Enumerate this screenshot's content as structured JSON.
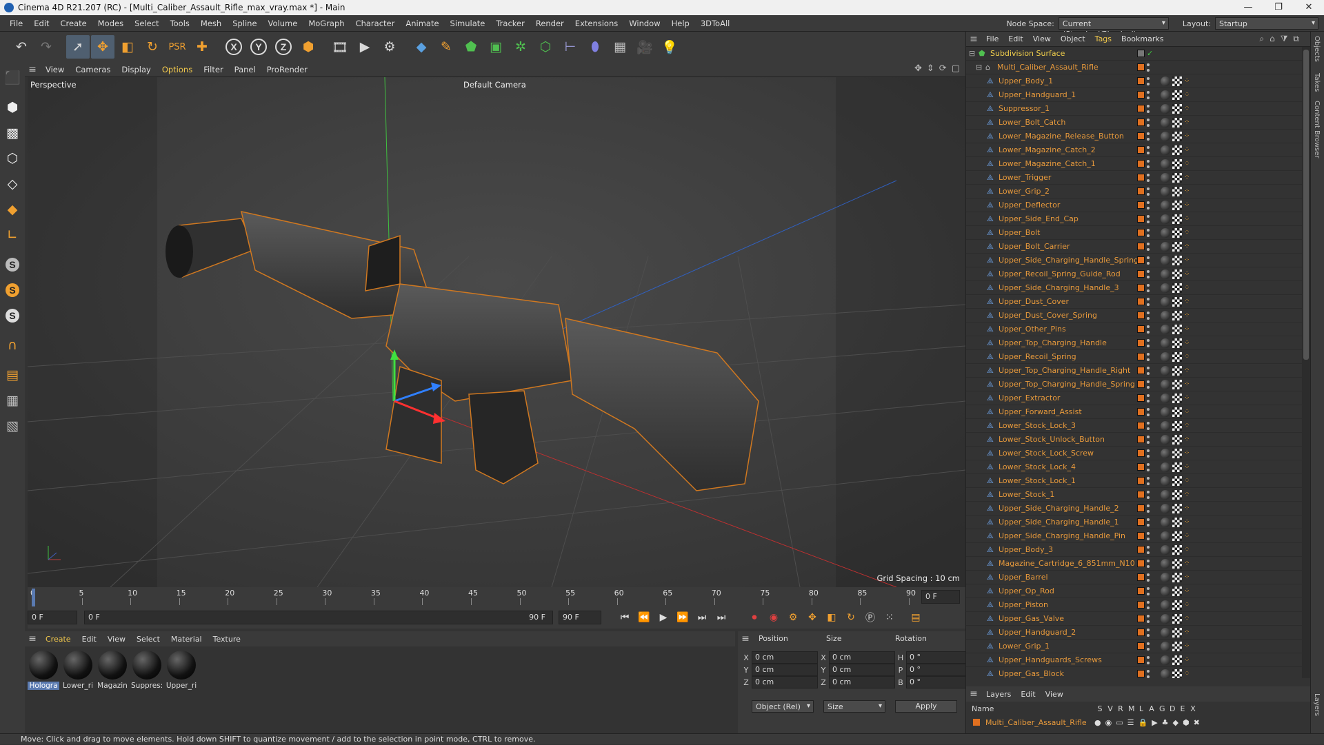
{
  "window": {
    "title": "Cinema 4D R21.207 (RC) - [Multi_Caliber_Assault_Rifle_max_vray.max *] - Main",
    "minimize": "—",
    "maximize": "❐",
    "close": "✕"
  },
  "menubar": {
    "items": [
      "File",
      "Edit",
      "Create",
      "Modes",
      "Select",
      "Tools",
      "Mesh",
      "Spline",
      "Volume",
      "MoGraph",
      "Character",
      "Animate",
      "Simulate",
      "Tracker",
      "Render",
      "Extensions",
      "Window",
      "Help",
      "3DToAll"
    ],
    "node_space_label": "Node Space:",
    "node_space_value": "Current (Standard/Physical)",
    "layout_label": "Layout:",
    "layout_value": "Startup"
  },
  "toolbar": {
    "icons": [
      "undo-icon",
      "redo-icon",
      "select-arrow-icon",
      "move-icon",
      "scale-icon",
      "rotate-icon",
      "psr-icon",
      "add-icon",
      "x-axis-icon",
      "y-axis-icon",
      "z-axis-icon",
      "coordinate-system-icon",
      "render-region-icon",
      "render-view-icon",
      "render-settings-icon",
      "cube-icon",
      "pen-icon",
      "subdivision-icon",
      "extrude-icon",
      "cloner-icon",
      "mograph-icon",
      "symmetry-icon",
      "deformer-icon",
      "floor-icon",
      "camera-icon",
      "light-icon"
    ]
  },
  "viewport": {
    "menu": [
      "View",
      "Cameras",
      "Display",
      "Options",
      "Filter",
      "Panel",
      "ProRender"
    ],
    "active_menu": "Options",
    "title": "Perspective",
    "camera": "Default Camera",
    "grid_spacing": "Grid Spacing : 10 cm"
  },
  "timeline": {
    "ticks": [
      "0",
      "5",
      "10",
      "15",
      "20",
      "25",
      "30",
      "35",
      "40",
      "45",
      "50",
      "55",
      "60",
      "65",
      "70",
      "75",
      "80",
      "85",
      "90"
    ],
    "current_frame_right": "0 F",
    "start_frame": "0 F",
    "preview_start": "0 F",
    "preview_end": "90 F",
    "end_frame": "90 F"
  },
  "material_manager": {
    "menu": [
      "Create",
      "Edit",
      "View",
      "Select",
      "Material",
      "Texture"
    ],
    "active_menu": "Create",
    "materials": [
      {
        "name": "Hologra",
        "selected": true
      },
      {
        "name": "Lower_ri",
        "selected": false
      },
      {
        "name": "Magazin",
        "selected": false
      },
      {
        "name": "Suppres:",
        "selected": false
      },
      {
        "name": "Upper_ri",
        "selected": false
      }
    ]
  },
  "coordinates": {
    "headers": [
      "Position",
      "Size",
      "Rotation"
    ],
    "rows": [
      {
        "axis": "X",
        "pos": "0 cm",
        "size_axis": "X",
        "size": "0 cm",
        "rot_axis": "H",
        "rot": "0 °"
      },
      {
        "axis": "Y",
        "pos": "0 cm",
        "size_axis": "Y",
        "size": "0 cm",
        "rot_axis": "P",
        "rot": "0 °"
      },
      {
        "axis": "Z",
        "pos": "0 cm",
        "size_axis": "Z",
        "size": "0 cm",
        "rot_axis": "B",
        "rot": "0 °"
      }
    ],
    "mode": "Object (Rel)",
    "size_mode": "Size",
    "apply": "Apply"
  },
  "object_manager": {
    "menu": [
      "File",
      "Edit",
      "View",
      "Object",
      "Tags",
      "Bookmarks"
    ],
    "active_menu": "Tags",
    "root": "Subdivision Surface",
    "group": "Multi_Caliber_Assault_Rifle",
    "objects": [
      "Upper_Body_1",
      "Upper_Handguard_1",
      "Suppressor_1",
      "Lower_Bolt_Catch",
      "Lower_Magazine_Release_Button",
      "Lower_Magazine_Catch_2",
      "Lower_Magazine_Catch_1",
      "Lower_Trigger",
      "Lower_Grip_2",
      "Upper_Deflector",
      "Upper_Side_End_Cap",
      "Upper_Bolt",
      "Upper_Bolt_Carrier",
      "Upper_Side_Charging_Handle_Spring",
      "Upper_Recoil_Spring_Guide_Rod",
      "Upper_Side_Charging_Handle_3",
      "Upper_Dust_Cover",
      "Upper_Dust_Cover_Spring",
      "Upper_Other_Pins",
      "Upper_Top_Charging_Handle",
      "Upper_Recoil_Spring",
      "Upper_Top_Charging_Handle_Right",
      "Upper_Top_Charging_Handle_Spring",
      "Upper_Extractor",
      "Upper_Forward_Assist",
      "Lower_Stock_Lock_3",
      "Lower_Stock_Unlock_Button",
      "Lower_Stock_Lock_Screw",
      "Lower_Stock_Lock_4",
      "Lower_Stock_Lock_1",
      "Lower_Stock_1",
      "Upper_Side_Charging_Handle_2",
      "Upper_Side_Charging_Handle_1",
      "Upper_Side_Charging_Handle_Pin",
      "Upper_Body_3",
      "Magazine_Cartridge_6_851mm_N10",
      "Upper_Barrel",
      "Upper_Op_Rod",
      "Upper_Piston",
      "Upper_Gas_Valve",
      "Upper_Handguard_2",
      "Lower_Grip_1",
      "Upper_Handguards_Screws",
      "Upper_Gas_Block"
    ]
  },
  "layers": {
    "menu": [
      "Layers",
      "Edit",
      "View"
    ],
    "header_name": "Name",
    "columns": [
      "S",
      "V",
      "R",
      "M",
      "L",
      "A",
      "G",
      "D",
      "E",
      "X"
    ],
    "layer_name": "Multi_Caliber_Assault_Rifle"
  },
  "side_tabs": [
    "Objects",
    "Takes",
    "Content Browser",
    "Layers"
  ],
  "status": "Move: Click and drag to move elements. Hold down SHIFT to quantize movement / add to the selection in point mode, CTRL to remove.",
  "colors": {
    "accent": "#f2c94c",
    "object_name": "#e89a3c",
    "layer_swatch": "#e07020"
  }
}
